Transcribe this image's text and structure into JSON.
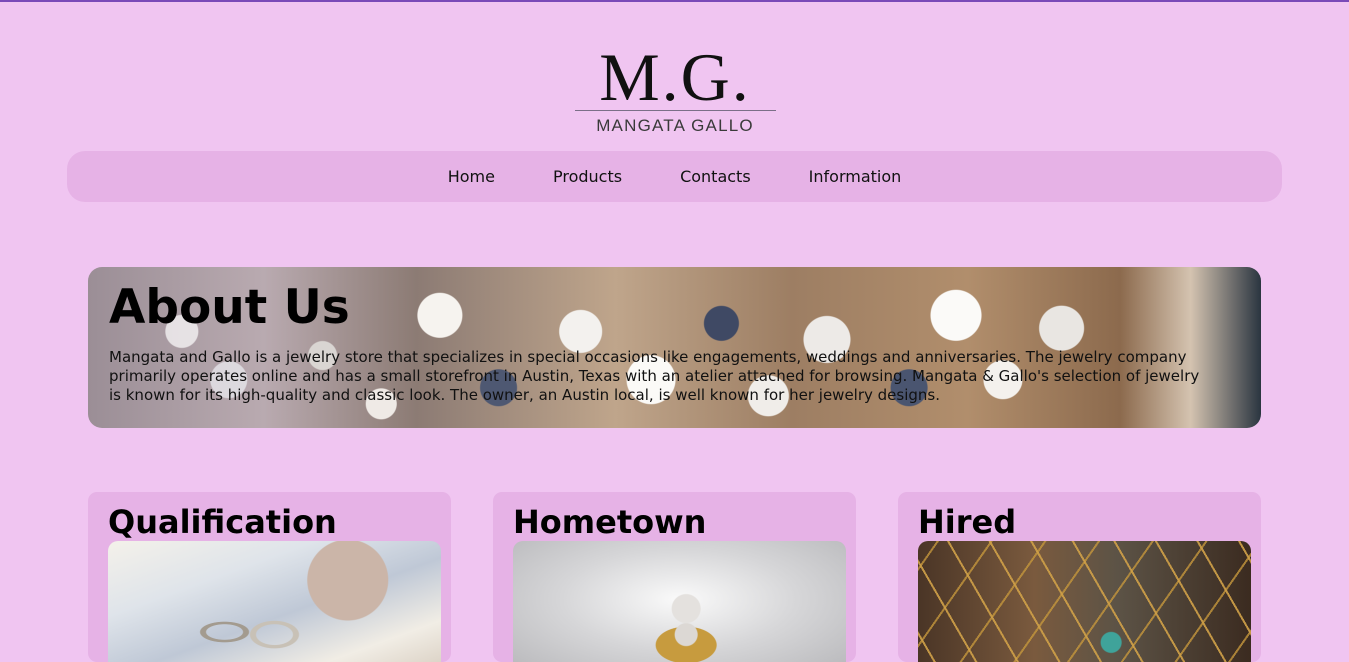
{
  "brand": {
    "logo_mark": "M.G.",
    "logo_sub": "MANGATA GALLO"
  },
  "nav": {
    "items": [
      {
        "label": "Home"
      },
      {
        "label": "Products"
      },
      {
        "label": "Contacts"
      },
      {
        "label": "Information"
      }
    ]
  },
  "about": {
    "title": "About Us",
    "text": "Mangata and Gallo is a jewelry store that specializes in special occasions like engagements, weddings and anniversaries. The jewelry company primarily operates online and has a small storefront in Austin, Texas with an atelier attached for browsing. Mangata & Gallo's selection of jewelry is known for its high-quality and classic look. The owner, an Austin local, is well known for her jewelry designs."
  },
  "cards": [
    {
      "title": "Qualification"
    },
    {
      "title": "Hometown"
    },
    {
      "title": "Hired"
    }
  ],
  "colors": {
    "page_background": "#f0c5f1",
    "panel_background": "#e6b2e6",
    "top_border": "#7a4ab8"
  }
}
